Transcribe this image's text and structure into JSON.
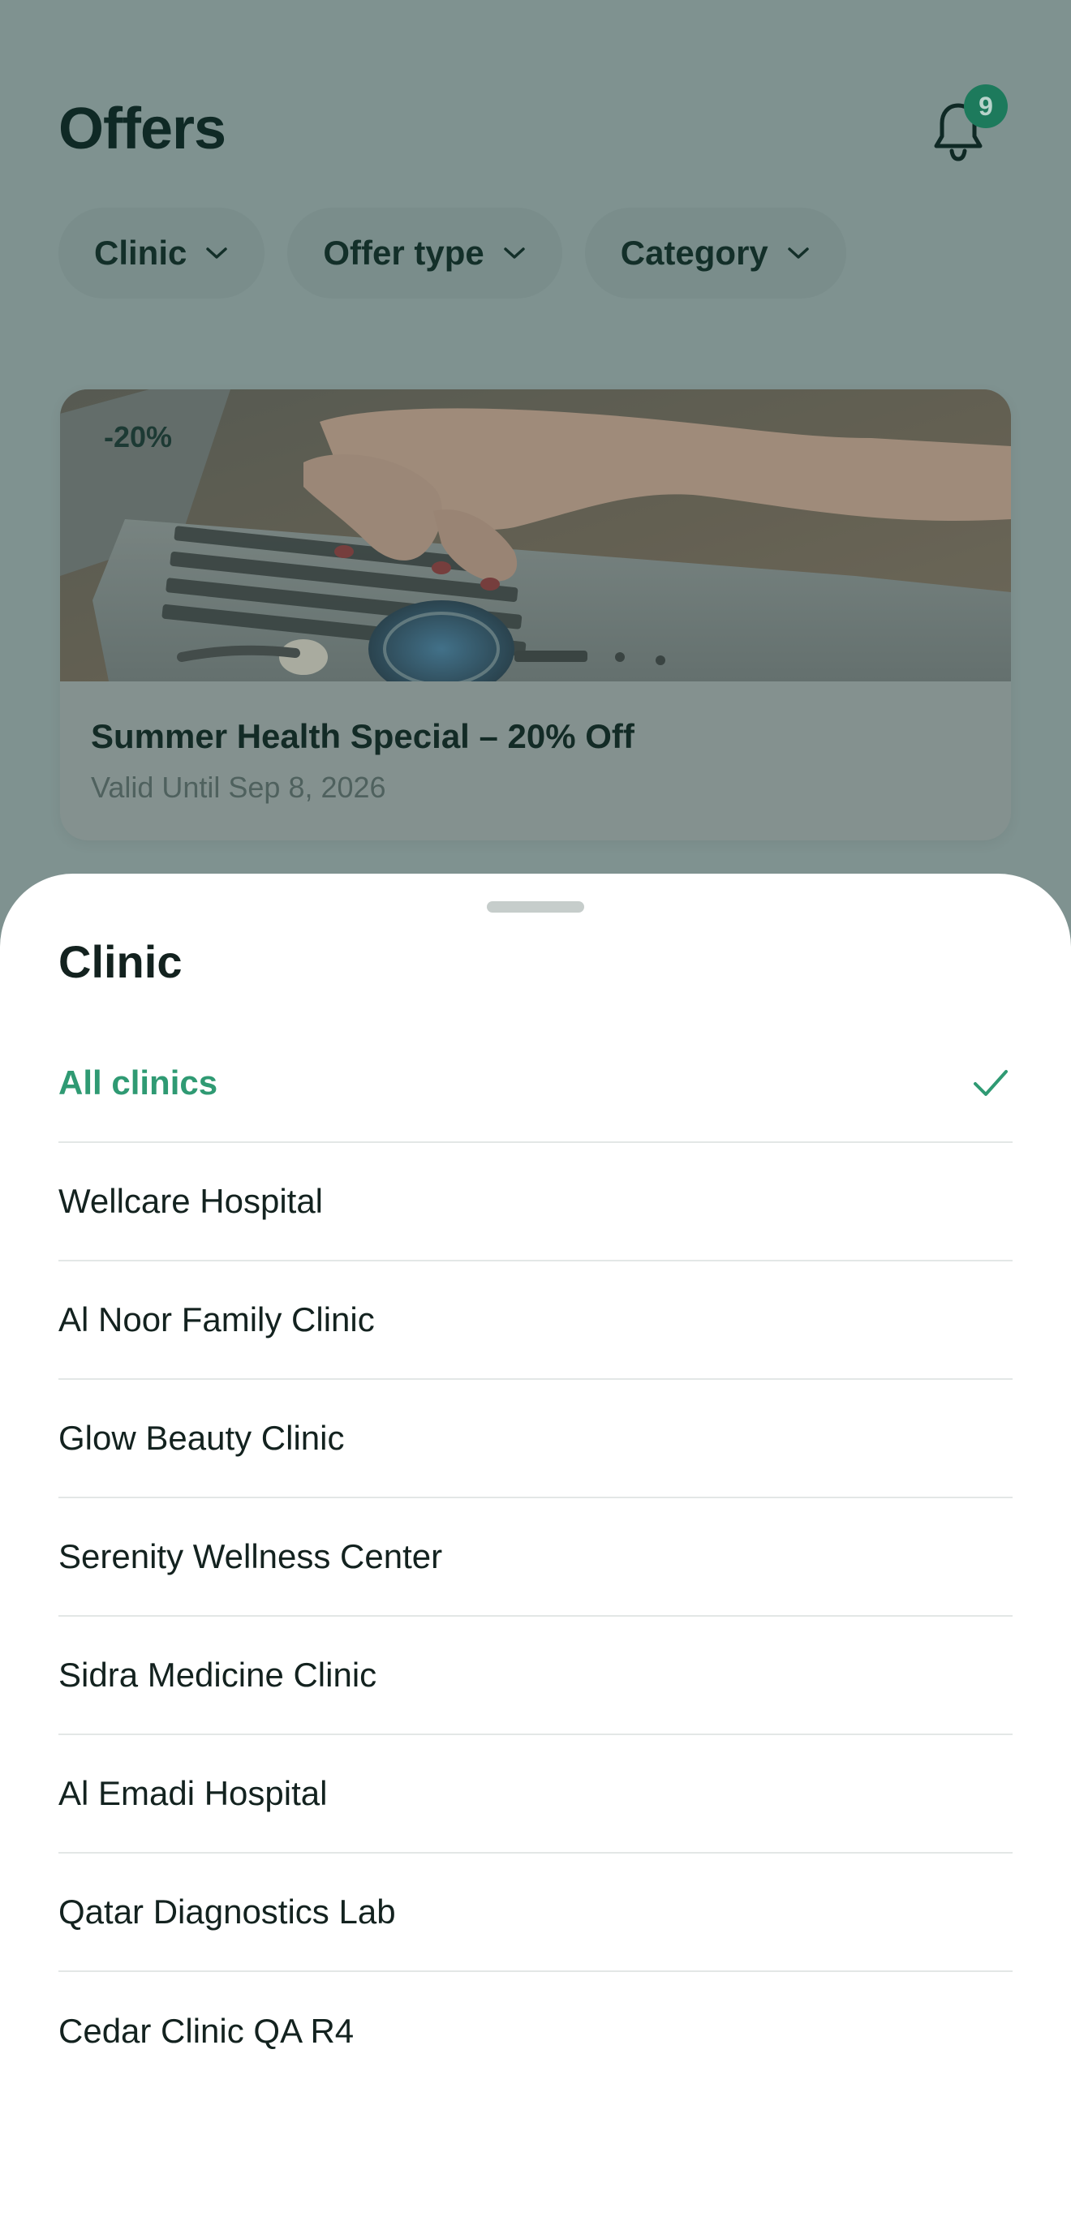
{
  "header": {
    "title": "Offers",
    "notification_count": "9",
    "notification_icon": "bell-icon"
  },
  "filters": [
    {
      "label": "Clinic"
    },
    {
      "label": "Offer type"
    },
    {
      "label": "Category"
    }
  ],
  "offer_card": {
    "discount": "-20%",
    "title": "Summer Health Special – 20% Off",
    "valid_until": "Valid Until Sep 8, 2026",
    "image": "photo-laptop-stethoscope"
  },
  "sheet": {
    "title": "Clinic",
    "selected_index": 0,
    "options": [
      {
        "label": "All clinics"
      },
      {
        "label": "Wellcare Hospital"
      },
      {
        "label": "Al Noor Family Clinic"
      },
      {
        "label": "Glow Beauty Clinic"
      },
      {
        "label": "Serenity Wellness Center"
      },
      {
        "label": "Sidra Medicine Clinic"
      },
      {
        "label": "Al Emadi Hospital"
      },
      {
        "label": "Qatar Diagnostics Lab"
      },
      {
        "label": "Cedar Clinic QA R4"
      }
    ]
  },
  "colors": {
    "accent": "#2f9a73",
    "badge": "#1d7a5c",
    "overlay": "#7f9290"
  }
}
